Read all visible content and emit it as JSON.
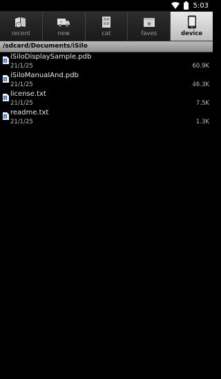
{
  "status_bar": {
    "time": "5:03",
    "icons": [
      "wifi-icon",
      "battery-icon"
    ]
  },
  "tabs": [
    {
      "label": "recent",
      "icon": "recent-books-icon",
      "active": false
    },
    {
      "label": "new",
      "icon": "new-truck-icon",
      "active": false
    },
    {
      "label": "cat",
      "icon": "catalog-cabinet-icon",
      "active": false
    },
    {
      "label": "faves",
      "icon": "faves-box-icon",
      "active": false
    },
    {
      "label": "device",
      "icon": "device-phone-icon",
      "active": true
    }
  ],
  "path": "/sdcard/Documents/iSilo",
  "files": [
    {
      "name": "iSiloDisplaySample.pdb",
      "date": "21/1/25",
      "size": "60.9K"
    },
    {
      "name": "iSiloManualAnd.pdb",
      "date": "21/1/25",
      "size": "46.3K"
    },
    {
      "name": "license.txt",
      "date": "21/1/25",
      "size": "7.5K"
    },
    {
      "name": "readme.txt",
      "date": "21/1/25",
      "size": "1.3K"
    }
  ],
  "colors": {
    "background": "#000000",
    "tab_active": "#d4d4d4",
    "path_bar": "#a5a5a5",
    "file_icon_blue": "#3a6ed8"
  }
}
